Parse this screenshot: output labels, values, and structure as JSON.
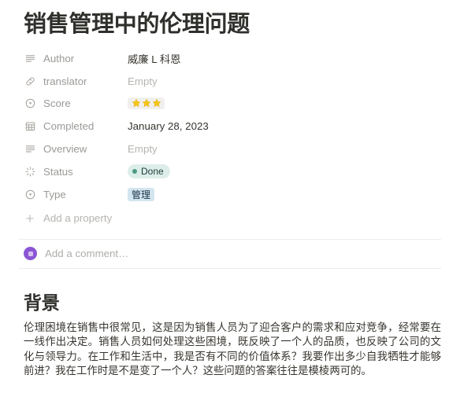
{
  "page": {
    "title": "销售管理中的伦理问题"
  },
  "properties": [
    {
      "icon": "text-lines-icon",
      "label": "Author",
      "value": "威廉 L 科恩",
      "kind": "text"
    },
    {
      "icon": "link-icon",
      "label": "translator",
      "value": "Empty",
      "kind": "empty"
    },
    {
      "icon": "select-icon",
      "label": "Score",
      "value": "⭐⭐⭐",
      "kind": "stars",
      "star_count": 3
    },
    {
      "icon": "calendar-icon",
      "label": "Completed",
      "value": "January 28, 2023",
      "kind": "date"
    },
    {
      "icon": "text-lines-icon",
      "label": "Overview",
      "value": "Empty",
      "kind": "empty"
    },
    {
      "icon": "status-icon",
      "label": "Status",
      "value": "Done",
      "kind": "status-pill"
    },
    {
      "icon": "select-icon",
      "label": "Type",
      "value": "管理",
      "kind": "type-badge"
    }
  ],
  "add_property": {
    "label": "Add a property",
    "icon": "plus-icon"
  },
  "comment": {
    "placeholder": "Add a comment…",
    "avatar_icon": "user-avatar"
  },
  "content": {
    "heading": "背景",
    "paragraph": "伦理困境在销售中很常见，这是因为销售人员为了迎合客户的需求和应对竞争，经常要在一线作出决定。销售人员如何处理这些困境，既反映了一个人的品质，也反映了公司的文化与领导力。在工作和生活中，我是否有不同的价值体系？我要作出多少自我牺牲才能够前进？我在工作时是不是变了一个人？这些问题的答案往往是模棱两可的。"
  },
  "colors": {
    "status_pill_bg": "#ddedea",
    "status_dot": "#4a9c7e",
    "type_badge_bg": "#d3e5ef",
    "avatar": "#8b55d4",
    "star": "#f5c518",
    "text": "#37352f",
    "muted": "#9b9a97"
  }
}
